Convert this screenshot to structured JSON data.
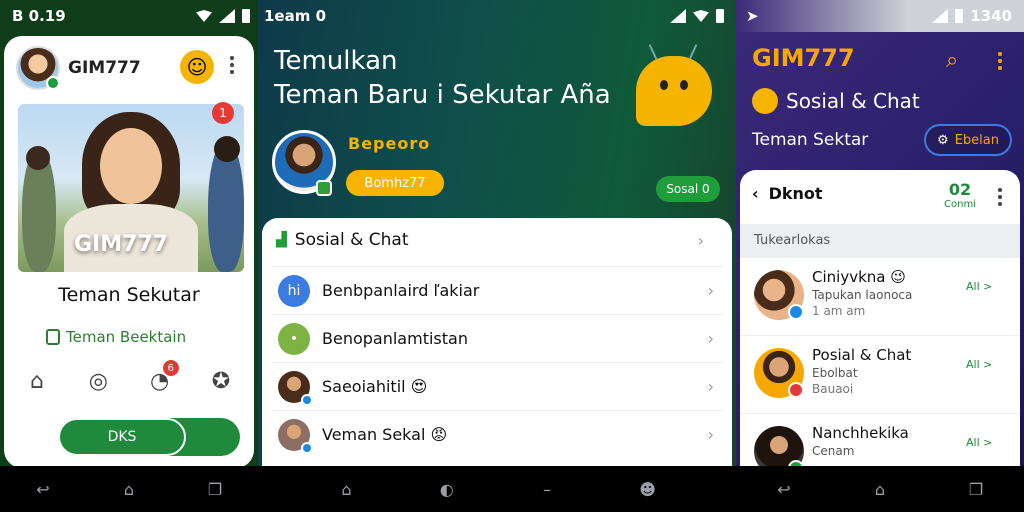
{
  "left": {
    "status_time": "B 0.19",
    "title": "GIM777",
    "photo_label": "GIM777",
    "photo_badge": "1",
    "heading": "Teman Sekutar",
    "subtitle": "Teman Beektain",
    "notif_count": "6",
    "button": "DKS"
  },
  "middle": {
    "status_time": "1eam 0",
    "headline1": "Temulkan",
    "headline2": "Teman Baru i Sekutar Aña",
    "brand": "Bepeoro",
    "yellow_pill": "Bomhz77",
    "green_pill": "Sosal 0",
    "list_header": "Sosial & Chat",
    "items": [
      {
        "label": "Benbpanlaird ľakiar",
        "color": "#3c7be0",
        "glyph": "hi"
      },
      {
        "label": "Benopanlamtistan",
        "color": "#7cb342",
        "glyph": "•"
      },
      {
        "label": "Saeoiahitil 😍",
        "color": "#4a2c1a",
        "glyph": ""
      },
      {
        "label": "Veman Sekal 😡",
        "color": "#8d6e63",
        "glyph": ""
      }
    ]
  },
  "right": {
    "status_time": "1340",
    "title": "GIM777",
    "subtitle": "Sosial & Chat",
    "subtitle2": "Teman Sektar",
    "tag": "Ebelan",
    "card_title": "Dknot",
    "count_num": "02",
    "count_label": "Conmi",
    "section_label": "Tukearlokas",
    "rows": [
      {
        "name": "Ciniyvkna 😉",
        "line2": "Tapukan laonoca",
        "line3": "1 am am",
        "action": "All >",
        "avatar": "#e9b48a",
        "badge": "#1e88e5"
      },
      {
        "name": "Posial & Chat",
        "line2": "Ebolbat",
        "line3": "Bauaoi",
        "action": "All >",
        "avatar": "#f6a800",
        "badge": "#e53935"
      },
      {
        "name": "Nanchhekika",
        "line2": "Cenam",
        "line3": "",
        "action": "All >",
        "avatar": "#4a2c1a",
        "badge": "#1f9d3a"
      }
    ]
  }
}
